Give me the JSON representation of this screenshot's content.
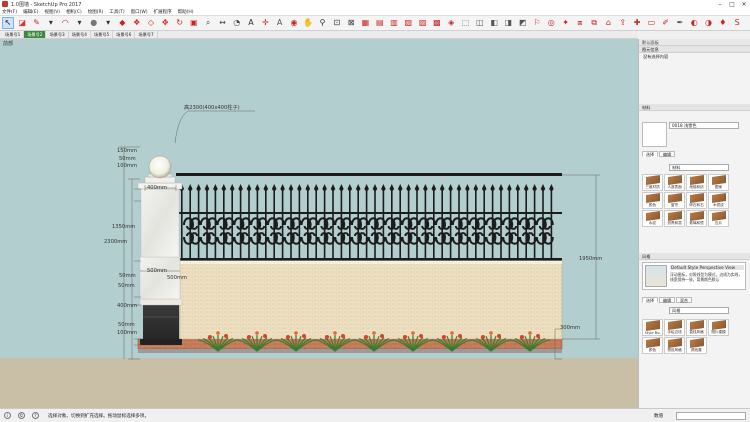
{
  "window": {
    "title": "1.0围墙 - SketchUp Pro 2017",
    "controls": [
      "–",
      "□",
      "✕"
    ]
  },
  "menu": [
    "文件(F)",
    "编辑(E)",
    "视图(V)",
    "相机(C)",
    "绘图(R)",
    "工具(T)",
    "窗口(W)",
    "扩展程序",
    "帮助(H)"
  ],
  "toolbar": {
    "icons": [
      {
        "name": "select-icon",
        "glyph": "↖",
        "color": "#222",
        "selected": true
      },
      {
        "name": "eraser-icon",
        "glyph": "◪",
        "color": "#d33"
      },
      {
        "name": "pencil-icon",
        "glyph": "✎",
        "color": "#c22"
      },
      {
        "name": "line-dropdown-icon",
        "glyph": "▾",
        "color": "#333"
      },
      {
        "name": "arc-icon",
        "glyph": "◠",
        "color": "#c22"
      },
      {
        "name": "arc-dropdown-icon",
        "glyph": "▾",
        "color": "#333"
      },
      {
        "name": "shape-icon",
        "glyph": "●",
        "color": "#777"
      },
      {
        "name": "shape-dropdown-icon",
        "glyph": "▾",
        "color": "#333"
      },
      {
        "name": "pushpull-icon",
        "glyph": "◆",
        "color": "#c22"
      },
      {
        "name": "followme-icon",
        "glyph": "❖",
        "color": "#c22"
      },
      {
        "name": "offset-icon",
        "glyph": "◇",
        "color": "#c22"
      },
      {
        "name": "move-icon",
        "glyph": "✥",
        "color": "#c22"
      },
      {
        "name": "rotate-icon",
        "glyph": "↻",
        "color": "#c22"
      },
      {
        "name": "scale-icon",
        "glyph": "▣",
        "color": "#c22"
      },
      {
        "name": "tape-icon",
        "glyph": "⌕",
        "color": "#444"
      },
      {
        "name": "dimension-icon",
        "glyph": "↔",
        "color": "#444"
      },
      {
        "name": "protractor-icon",
        "glyph": "◔",
        "color": "#444"
      },
      {
        "name": "text-icon",
        "glyph": "A",
        "color": "#333"
      },
      {
        "name": "axes-icon",
        "glyph": "✛",
        "color": "#c22"
      },
      {
        "name": "3dtext-icon",
        "glyph": "A",
        "color": "#555"
      },
      {
        "name": "orbit-icon",
        "glyph": "◉",
        "color": "#c22"
      },
      {
        "name": "pan-icon",
        "glyph": "✋",
        "color": "#c22"
      },
      {
        "name": "zoom-icon",
        "glyph": "⚲",
        "color": "#333"
      },
      {
        "name": "zoom-window-icon",
        "glyph": "⊡",
        "color": "#333"
      },
      {
        "name": "zoom-extents-icon",
        "glyph": "⊠",
        "color": "#333"
      },
      {
        "name": "iso-view-icon",
        "glyph": "▦",
        "color": "#c22"
      },
      {
        "name": "top-view-icon",
        "glyph": "▤",
        "color": "#c22"
      },
      {
        "name": "front-view-icon",
        "glyph": "▥",
        "color": "#c22"
      },
      {
        "name": "right-view-icon",
        "glyph": "▧",
        "color": "#c22"
      },
      {
        "name": "back-view-icon",
        "glyph": "▨",
        "color": "#c22"
      },
      {
        "name": "left-view-icon",
        "glyph": "▩",
        "color": "#c22"
      },
      {
        "name": "xray-icon",
        "glyph": "◈",
        "color": "#c22"
      },
      {
        "name": "wireframe-icon",
        "glyph": "⬚",
        "color": "#555"
      },
      {
        "name": "hidden-line-icon",
        "glyph": "◫",
        "color": "#555"
      },
      {
        "name": "shaded-icon",
        "glyph": "◧",
        "color": "#555"
      },
      {
        "name": "textured-icon",
        "glyph": "◨",
        "color": "#555"
      },
      {
        "name": "monochrome-icon",
        "glyph": "◩",
        "color": "#555"
      },
      {
        "name": "walk-icon",
        "glyph": "⚐",
        "color": "#c22"
      },
      {
        "name": "lookaround-icon",
        "glyph": "◎",
        "color": "#c22"
      },
      {
        "name": "position-camera-icon",
        "glyph": "✦",
        "color": "#c22"
      },
      {
        "name": "section-plane-icon",
        "glyph": "⧈",
        "color": "#c22"
      },
      {
        "name": "section-cuts-icon",
        "glyph": "⧉",
        "color": "#c22"
      },
      {
        "name": "warehouse-icon",
        "glyph": "⌂",
        "color": "#c22"
      },
      {
        "name": "share-model-icon",
        "glyph": "⇪",
        "color": "#c22"
      },
      {
        "name": "extension-warehouse-icon",
        "glyph": "✚",
        "color": "#c22"
      },
      {
        "name": "layout-icon",
        "glyph": "▭",
        "color": "#c22"
      },
      {
        "name": "paint-icon",
        "glyph": "✐",
        "color": "#c22"
      },
      {
        "name": "styles-icon",
        "glyph": "✒",
        "color": "#555"
      },
      {
        "name": "eye-icon",
        "glyph": "◐",
        "color": "#c22"
      },
      {
        "name": "shadow-icon",
        "glyph": "◑",
        "color": "#c22"
      },
      {
        "name": "ruby-icon",
        "glyph": "♦",
        "color": "#c22"
      },
      {
        "name": "su-icon",
        "glyph": "S",
        "color": "#c22"
      }
    ]
  },
  "scene_tabs": [
    {
      "label": "场景号1",
      "active": false
    },
    {
      "label": "场景号2",
      "active": true
    },
    {
      "label": "场景号3",
      "active": false
    },
    {
      "label": "场景号4",
      "active": false
    },
    {
      "label": "场景号5",
      "active": false
    },
    {
      "label": "场景号6",
      "active": false
    },
    {
      "label": "场景号7",
      "active": false
    }
  ],
  "viewport": {
    "view_label": "前部",
    "annotation": "高2300(400x400柱子)",
    "dimensions": {
      "post_cap": "150mm",
      "post_cap_band": "50mm",
      "post_neck": "100mm",
      "post_width": "400mm",
      "post_shaft": "1350mm",
      "post_total": "2300mm",
      "post_belt": "50mm",
      "wall_top_width": "500mm",
      "base_width_right": "500mm",
      "plinth_band": "50mm",
      "plinth_height": "400mm",
      "base_band": "50mm",
      "base_foot": "100mm",
      "fence_total": "1950mm",
      "wall_base": "300mm"
    }
  },
  "tray": {
    "title": "默认面板",
    "entity_info": "图元信息",
    "no_selection": "没有选择内容",
    "materials_header": "材料",
    "material_name": "0018 浅雪色",
    "tabs": [
      "选择",
      "编辑"
    ],
    "category": "材料",
    "thumbs": [
      "三维材质",
      "人造表面",
      "地毯和纺",
      "图案",
      "颜色",
      "窗帘",
      "碎石和石",
      "木质纹",
      "水纹",
      "沥青和混",
      "玻璃和镜",
      "瓦片"
    ],
    "styles_header": "风格",
    "style_name": "Default Style Perspective View",
    "style_desc": "浮动图标，对照线型为模式，边线为实线，线宽保持一致，背景颜色默认",
    "tabs2": [
      "选择",
      "编辑",
      "混合"
    ],
    "style_category": "风格",
    "style_thumbs": [
      "Style Bui",
      "手绘边线",
      "直线风格",
      "照片建模",
      "颜色",
      "预设风格",
      "颜色集"
    ]
  },
  "status": {
    "message": "选择对象。切换到扩充选择。拖动鼠标选择多项。",
    "measure_label": "数值",
    "measure_value": ""
  }
}
